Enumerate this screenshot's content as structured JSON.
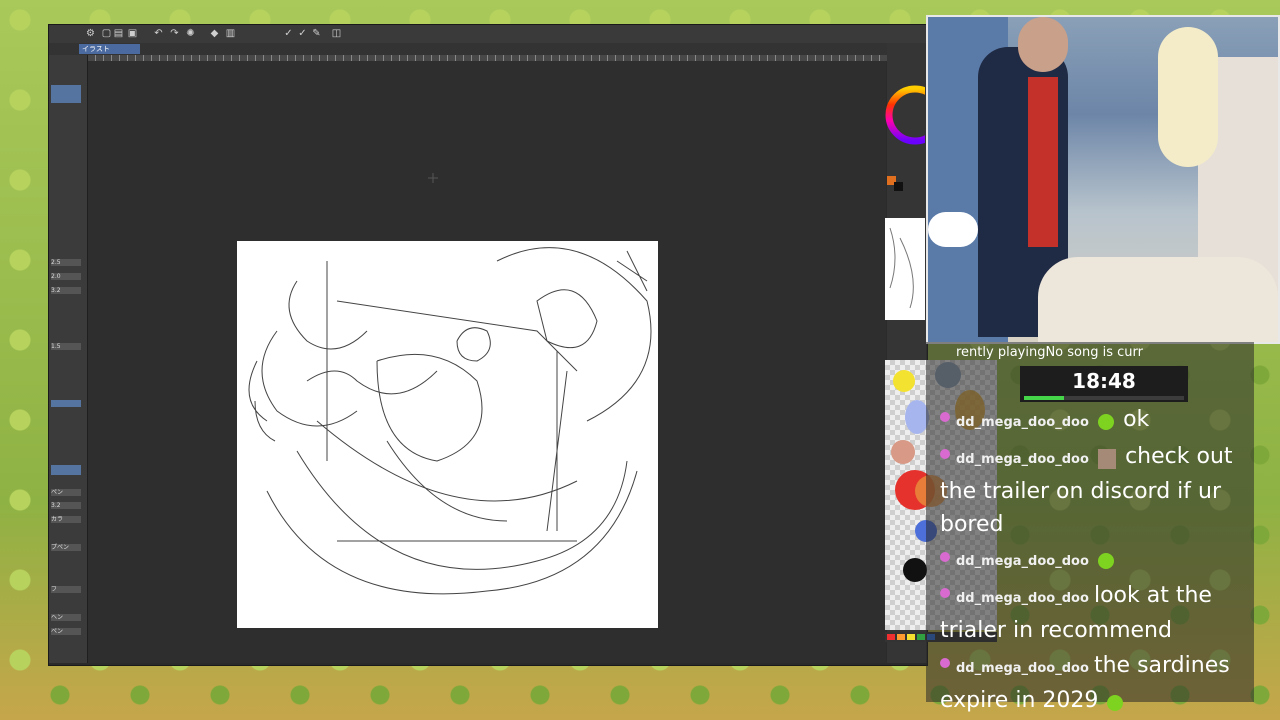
{
  "app": {
    "tab_label": "イラスト",
    "left_panel_items": [
      "2.5",
      "2.0",
      "3.2",
      "1.5",
      "ペン",
      "3.2",
      "カラ",
      "プペン",
      "フ",
      "ヘン",
      "ペン"
    ]
  },
  "stream": {
    "now_playing": "rently playingNo song is curr",
    "timer": {
      "text": "18:48",
      "progress": 0.25,
      "fill_color": "#46d64a"
    }
  },
  "chat": [
    {
      "user": "dd_mega_doo_doo",
      "emote": "green-blob-emote",
      "text": "ok"
    },
    {
      "user": "dd_mega_doo_doo",
      "emote": "face-emote",
      "text": "check out the trailer on discord if ur bored"
    },
    {
      "user": "dd_mega_doo_doo",
      "emote": "green-blob-emote",
      "text": ""
    },
    {
      "user": "dd_mega_doo_doo",
      "emote": "",
      "text": "look at the trialer in recommend"
    },
    {
      "user": "dd_mega_doo_doo",
      "emote": "",
      "text": "the sardines expire in 2029"
    }
  ],
  "colors": {
    "app_bg": "#2b2b2b",
    "tab_active": "#4a6aa0",
    "palette_swatches": [
      "#f03030",
      "#ff9a30",
      "#f5e030",
      "#30a040",
      "#3070e0"
    ]
  }
}
